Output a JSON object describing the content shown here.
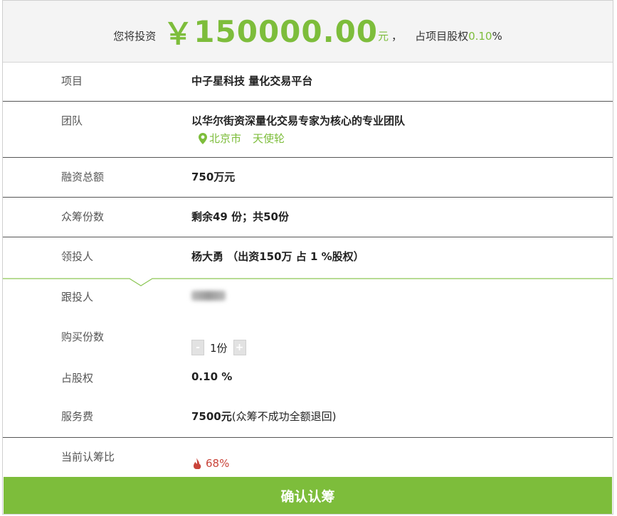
{
  "header": {
    "prefix": "您将投资",
    "currency": "￥",
    "amount": "150000.00",
    "unit": "元",
    "sep": "，",
    "share_prefix": "占项目股权",
    "share_value": "0.10",
    "share_suffix": "%"
  },
  "rows": {
    "project": {
      "label": "项目",
      "value": "中子星科技 量化交易平台"
    },
    "team": {
      "label": "团队",
      "value": "以华尔街资深量化交易专家为核心的专业团队",
      "city": "北京市",
      "stage": "天使轮"
    },
    "total": {
      "label": "融资总额",
      "value": "750万元"
    },
    "shares": {
      "label": "众筹份数",
      "value": "剩余49 份；共50份"
    },
    "lead": {
      "label": "领投人",
      "value": "杨大勇 （出资150万 占 1 %股权）"
    },
    "follow": {
      "label": "跟投人"
    },
    "buy": {
      "label": "购买份数",
      "minus": "-",
      "quantity": "1份",
      "plus": "+"
    },
    "equity": {
      "label": "占股权",
      "value": "0.10 %"
    },
    "fee": {
      "label": "服务费",
      "amount": "7500元",
      "note": "(众筹不成功全额退回)"
    },
    "ratio": {
      "label": "当前认筹比",
      "value": "68%"
    }
  },
  "confirm": {
    "label": "确认认筹"
  },
  "colors": {
    "accent": "#7dbd3b",
    "ratio": "#c9443a"
  },
  "icons": {
    "location": "map-pin-icon",
    "ratio": "flame-icon"
  }
}
